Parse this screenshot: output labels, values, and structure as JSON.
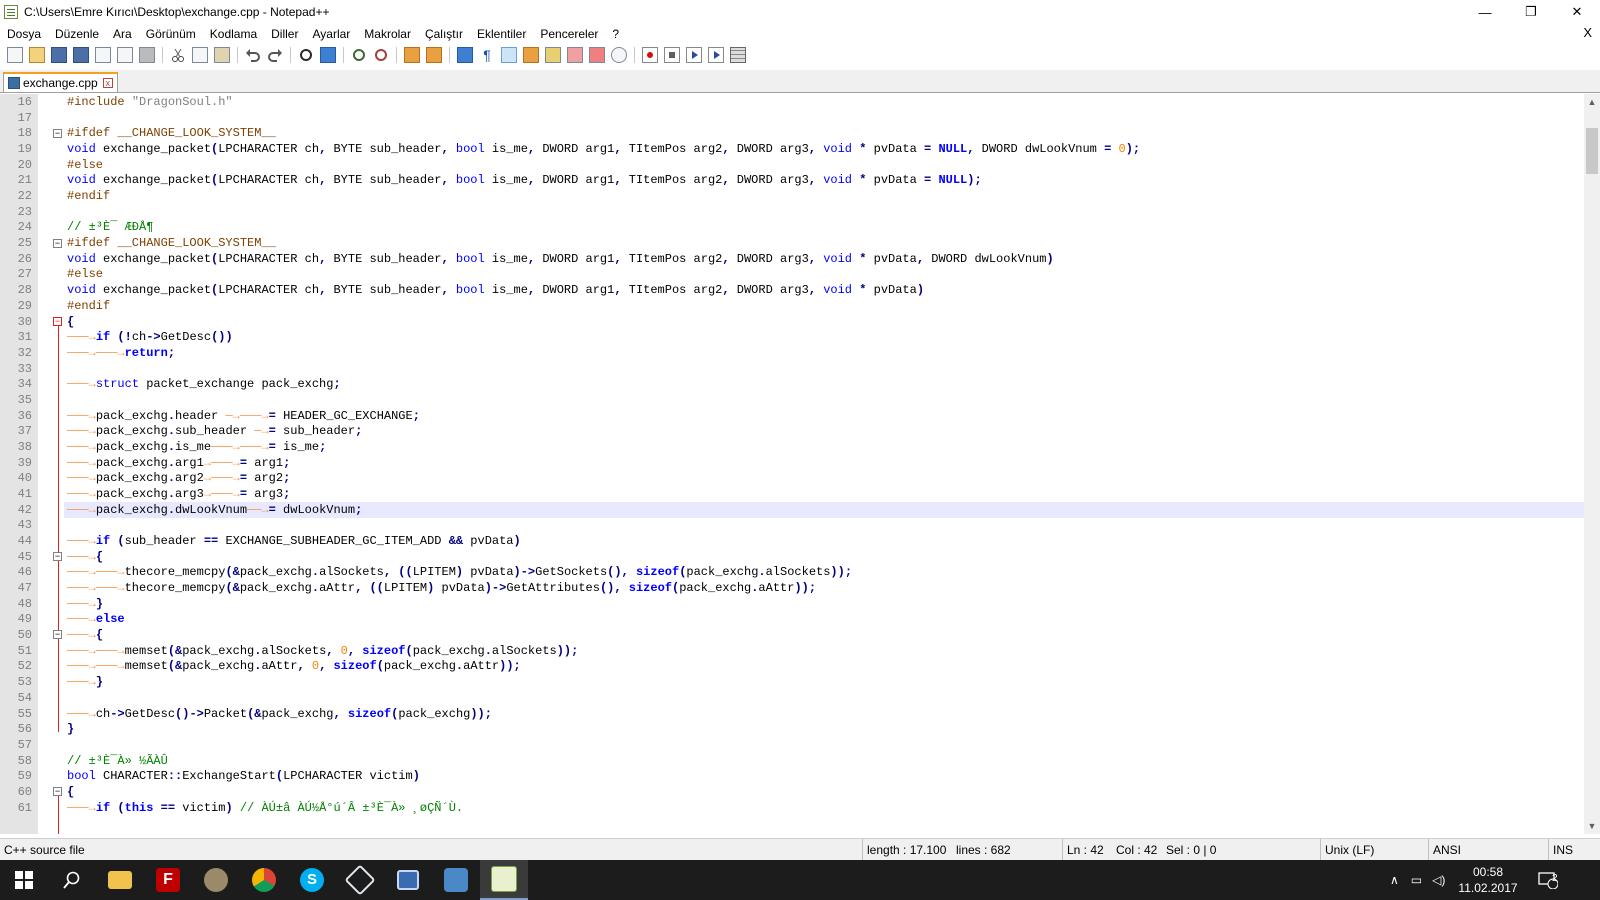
{
  "window": {
    "title": "C:\\Users\\Emre Kırıcı\\Desktop\\exchange.cpp - Notepad++",
    "controls": {
      "minimize": "—",
      "maximize": "❐",
      "close": "✕"
    }
  },
  "menu": {
    "items": [
      "Dosya",
      "Düzenle",
      "Ara",
      "Görünüm",
      "Kodlama",
      "Diller",
      "Ayarlar",
      "Makrolar",
      "Çalıştır",
      "Eklentiler",
      "Pencereler",
      "?"
    ],
    "close_label": "X"
  },
  "toolbar": {
    "buttons": [
      "new-file-icon",
      "open-file-icon",
      "save-icon",
      "save-all-icon",
      "close-icon",
      "close-all-icon",
      "print-icon",
      "cut-icon",
      "copy-icon",
      "paste-icon",
      "undo-icon",
      "redo-icon",
      "find-icon",
      "replace-icon",
      "zoom-in-icon",
      "zoom-out-icon",
      "sync-vertical-icon",
      "sync-horizontal-icon",
      "word-wrap-icon",
      "show-all-chars-icon",
      "indent-guide-icon",
      "user-lang-icon",
      "doc-map-icon",
      "function-list-icon",
      "folder-workspace-icon",
      "monitor-icon",
      "record-macro-icon",
      "stop-macro-icon",
      "play-macro-icon",
      "run-macro-multiple-icon",
      "save-macro-icon"
    ]
  },
  "tabs": [
    {
      "label": "exchange.cpp",
      "close": "x"
    }
  ],
  "editor": {
    "current_line": 42,
    "lines": [
      {
        "n": "16",
        "html": "<span class=\"pp\">#include </span><span class=\"str\">\"DragonSoul.h\"</span>"
      },
      {
        "n": "17",
        "html": ""
      },
      {
        "n": "18",
        "html": "<span class=\"pp\">#ifdef __CHANGE_LOOK_SYSTEM__</span>"
      },
      {
        "n": "19",
        "html": "<span class=\"kw\">void</span> exchange_packet<span class=\"op\">(</span>LPCHARACTER ch<span class=\"op\">,</span> BYTE sub_header<span class=\"op\">,</span> <span class=\"kw\">bool</span> is_me<span class=\"op\">,</span> DWORD arg1<span class=\"op\">,</span> TItemPos arg2<span class=\"op\">,</span> DWORD arg3<span class=\"op\">,</span> <span class=\"kw\">void</span> <span class=\"op\">*</span> pvData <span class=\"op\">=</span> <span class=\"kwb\">NULL</span><span class=\"op\">,</span> DWORD dwLookVnum <span class=\"op\">=</span> <span class=\"num\">0</span><span class=\"op\">);</span>"
      },
      {
        "n": "20",
        "html": "<span class=\"pp\">#else</span>"
      },
      {
        "n": "21",
        "html": "<span class=\"kw\">void</span> exchange_packet<span class=\"op\">(</span>LPCHARACTER ch<span class=\"op\">,</span> BYTE sub_header<span class=\"op\">,</span> <span class=\"kw\">bool</span> is_me<span class=\"op\">,</span> DWORD arg1<span class=\"op\">,</span> TItemPos arg2<span class=\"op\">,</span> DWORD arg3<span class=\"op\">,</span> <span class=\"kw\">void</span> <span class=\"op\">*</span> pvData <span class=\"op\">=</span> <span class=\"kwb\">NULL</span><span class=\"op\">);</span>"
      },
      {
        "n": "22",
        "html": "<span class=\"pp\">#endif</span>"
      },
      {
        "n": "23",
        "html": ""
      },
      {
        "n": "24",
        "html": "<span class=\"cm\">// ±³È¯ ÆÐÅ¶</span>"
      },
      {
        "n": "25",
        "html": "<span class=\"pp\">#ifdef __CHANGE_LOOK_SYSTEM__</span>"
      },
      {
        "n": "26",
        "html": "<span class=\"kw\">void</span> exchange_packet<span class=\"op\">(</span>LPCHARACTER ch<span class=\"op\">,</span> BYTE sub_header<span class=\"op\">,</span> <span class=\"kw\">bool</span> is_me<span class=\"op\">,</span> DWORD arg1<span class=\"op\">,</span> TItemPos arg2<span class=\"op\">,</span> DWORD arg3<span class=\"op\">,</span> <span class=\"kw\">void</span> <span class=\"op\">*</span> pvData<span class=\"op\">,</span> DWORD dwLookVnum<span class=\"op\">)</span>"
      },
      {
        "n": "27",
        "html": "<span class=\"pp\">#else</span>"
      },
      {
        "n": "28",
        "html": "<span class=\"kw\">void</span> exchange_packet<span class=\"op\">(</span>LPCHARACTER ch<span class=\"op\">,</span> BYTE sub_header<span class=\"op\">,</span> <span class=\"kw\">bool</span> is_me<span class=\"op\">,</span> DWORD arg1<span class=\"op\">,</span> TItemPos arg2<span class=\"op\">,</span> DWORD arg3<span class=\"op\">,</span> <span class=\"kw\">void</span> <span class=\"op\">*</span> pvData<span class=\"op\">)</span>"
      },
      {
        "n": "29",
        "html": "<span class=\"pp\">#endif</span>"
      },
      {
        "n": "30",
        "html": "<span class=\"op\">{</span>"
      },
      {
        "n": "31",
        "html": "<span class=\"tabarrow\">───→</span><span class=\"kwb\">if</span> <span class=\"op\">(!</span>ch<span class=\"op\">-&gt;</span>GetDesc<span class=\"op\">())</span>"
      },
      {
        "n": "32",
        "html": "<span class=\"tabarrow\">───→───→</span><span class=\"kwb\">return</span><span class=\"op\">;</span>"
      },
      {
        "n": "33",
        "html": ""
      },
      {
        "n": "34",
        "html": "<span class=\"tabarrow\">───→</span><span class=\"kw\">struct</span> packet_exchange pack_exchg<span class=\"op\">;</span>"
      },
      {
        "n": "35",
        "html": ""
      },
      {
        "n": "36",
        "html": "<span class=\"tabarrow\">───→</span>pack_exchg<span class=\"op\">.</span>header <span class=\"tabarrow\">─→───→</span><span class=\"op\">=</span> HEADER_GC_EXCHANGE<span class=\"op\">;</span>"
      },
      {
        "n": "37",
        "html": "<span class=\"tabarrow\">───→</span>pack_exchg<span class=\"op\">.</span>sub_header <span class=\"tabarrow\">─→</span><span class=\"op\">=</span> sub_header<span class=\"op\">;</span>"
      },
      {
        "n": "38",
        "html": "<span class=\"tabarrow\">───→</span>pack_exchg<span class=\"op\">.</span>is_me<span class=\"tabarrow\">───→───→</span><span class=\"op\">=</span> is_me<span class=\"op\">;</span>"
      },
      {
        "n": "39",
        "html": "<span class=\"tabarrow\">───→</span>pack_exchg<span class=\"op\">.</span>arg1<span class=\"tabarrow\">→───→</span><span class=\"op\">=</span> arg1<span class=\"op\">;</span>"
      },
      {
        "n": "40",
        "html": "<span class=\"tabarrow\">───→</span>pack_exchg<span class=\"op\">.</span>arg2<span class=\"tabarrow\">→───→</span><span class=\"op\">=</span> arg2<span class=\"op\">;</span>"
      },
      {
        "n": "41",
        "html": "<span class=\"tabarrow\">───→</span>pack_exchg<span class=\"op\">.</span>arg3<span class=\"tabarrow\">→───→</span><span class=\"op\">=</span> arg3<span class=\"op\">;</span>"
      },
      {
        "n": "42",
        "html": "<span class=\"tabarrow\">───→</span>pack_exchg<span class=\"op\">.</span>dwLookVnum<span class=\"tabarrow\">──→</span><span class=\"op\">=</span> dwLookVnum<span class=\"op\">;</span>"
      },
      {
        "n": "43",
        "html": ""
      },
      {
        "n": "44",
        "html": "<span class=\"tabarrow\">───→</span><span class=\"kwb\">if</span> <span class=\"op\">(</span>sub_header <span class=\"op\">==</span> EXCHANGE_SUBHEADER_GC_ITEM_ADD <span class=\"op\">&amp;&amp;</span> pvData<span class=\"op\">)</span>"
      },
      {
        "n": "45",
        "html": "<span class=\"tabarrow\">───→</span><span class=\"op\">{</span>"
      },
      {
        "n": "46",
        "html": "<span class=\"tabarrow\">───→───→</span>thecore_memcpy<span class=\"op\">(&amp;</span>pack_exchg<span class=\"op\">.</span>alSockets<span class=\"op\">,</span> <span class=\"op\">((</span>LPITEM<span class=\"op\">)</span> pvData<span class=\"op\">)-&gt;</span>GetSockets<span class=\"op\">(),</span> <span class=\"kwb\">sizeof</span><span class=\"op\">(</span>pack_exchg<span class=\"op\">.</span>alSockets<span class=\"op\">));</span>"
      },
      {
        "n": "47",
        "html": "<span class=\"tabarrow\">───→───→</span>thecore_memcpy<span class=\"op\">(&amp;</span>pack_exchg<span class=\"op\">.</span>aAttr<span class=\"op\">,</span> <span class=\"op\">((</span>LPITEM<span class=\"op\">)</span> pvData<span class=\"op\">)-&gt;</span>GetAttributes<span class=\"op\">(),</span> <span class=\"kwb\">sizeof</span><span class=\"op\">(</span>pack_exchg<span class=\"op\">.</span>aAttr<span class=\"op\">));</span>"
      },
      {
        "n": "48",
        "html": "<span class=\"tabarrow\">───→</span><span class=\"op\">}</span>"
      },
      {
        "n": "49",
        "html": "<span class=\"tabarrow\">───→</span><span class=\"kwb\">else</span>"
      },
      {
        "n": "50",
        "html": "<span class=\"tabarrow\">───→</span><span class=\"op\">{</span>"
      },
      {
        "n": "51",
        "html": "<span class=\"tabarrow\">───→───→</span>memset<span class=\"op\">(&amp;</span>pack_exchg<span class=\"op\">.</span>alSockets<span class=\"op\">,</span> <span class=\"num\">0</span><span class=\"op\">,</span> <span class=\"kwb\">sizeof</span><span class=\"op\">(</span>pack_exchg<span class=\"op\">.</span>alSockets<span class=\"op\">));</span>"
      },
      {
        "n": "52",
        "html": "<span class=\"tabarrow\">───→───→</span>memset<span class=\"op\">(&amp;</span>pack_exchg<span class=\"op\">.</span>aAttr<span class=\"op\">,</span> <span class=\"num\">0</span><span class=\"op\">,</span> <span class=\"kwb\">sizeof</span><span class=\"op\">(</span>pack_exchg<span class=\"op\">.</span>aAttr<span class=\"op\">));</span>"
      },
      {
        "n": "53",
        "html": "<span class=\"tabarrow\">───→</span><span class=\"op\">}</span>"
      },
      {
        "n": "54",
        "html": ""
      },
      {
        "n": "55",
        "html": "<span class=\"tabarrow\">───→</span>ch<span class=\"op\">-&gt;</span>GetDesc<span class=\"op\">()-&gt;</span>Packet<span class=\"op\">(&amp;</span>pack_exchg<span class=\"op\">,</span> <span class=\"kwb\">sizeof</span><span class=\"op\">(</span>pack_exchg<span class=\"op\">));</span>"
      },
      {
        "n": "56",
        "html": "<span class=\"op\">}</span>"
      },
      {
        "n": "57",
        "html": ""
      },
      {
        "n": "58",
        "html": "<span class=\"cm\">// ±³È¯À» ½ÃÀÛ</span>"
      },
      {
        "n": "59",
        "html": "<span class=\"kw\">bool</span> CHARACTER<span class=\"op\">::</span>ExchangeStart<span class=\"op\">(</span>LPCHARACTER victim<span class=\"op\">)</span>"
      },
      {
        "n": "60",
        "html": "<span class=\"op\">{</span>"
      },
      {
        "n": "61",
        "html": "<span class=\"tabarrow\">───→</span><span class=\"kwb\">if</span> <span class=\"op\">(</span><span class=\"kwb\">this</span> <span class=\"op\">==</span> victim<span class=\"op\">)</span> <span class=\"cm\">// ÀÚ±â ÀÚ½Å°ú´Â ±³È¯À» ¸øÇÑ´Ù.</span>"
      }
    ]
  },
  "status": {
    "filetype": "C++ source file",
    "length": "length : 17.100",
    "lines": "lines : 682",
    "ln": "Ln : 42",
    "col": "Col : 42",
    "sel": "Sel : 0 | 0",
    "eol": "Unix (LF)",
    "encoding": "ANSI",
    "mode": "INS"
  },
  "taskbar": {
    "apps": [
      "start-icon",
      "search-icon",
      "file-explorer-icon",
      "filezilla-icon",
      "metin2-icon",
      "chrome-icon",
      "skype-icon",
      "virtualbox-icon",
      "network-tool-icon",
      "rdp-icon",
      "notepadpp-icon"
    ],
    "clock_time": "00:58",
    "clock_date": "11.02.2017",
    "notification_count": "2"
  }
}
